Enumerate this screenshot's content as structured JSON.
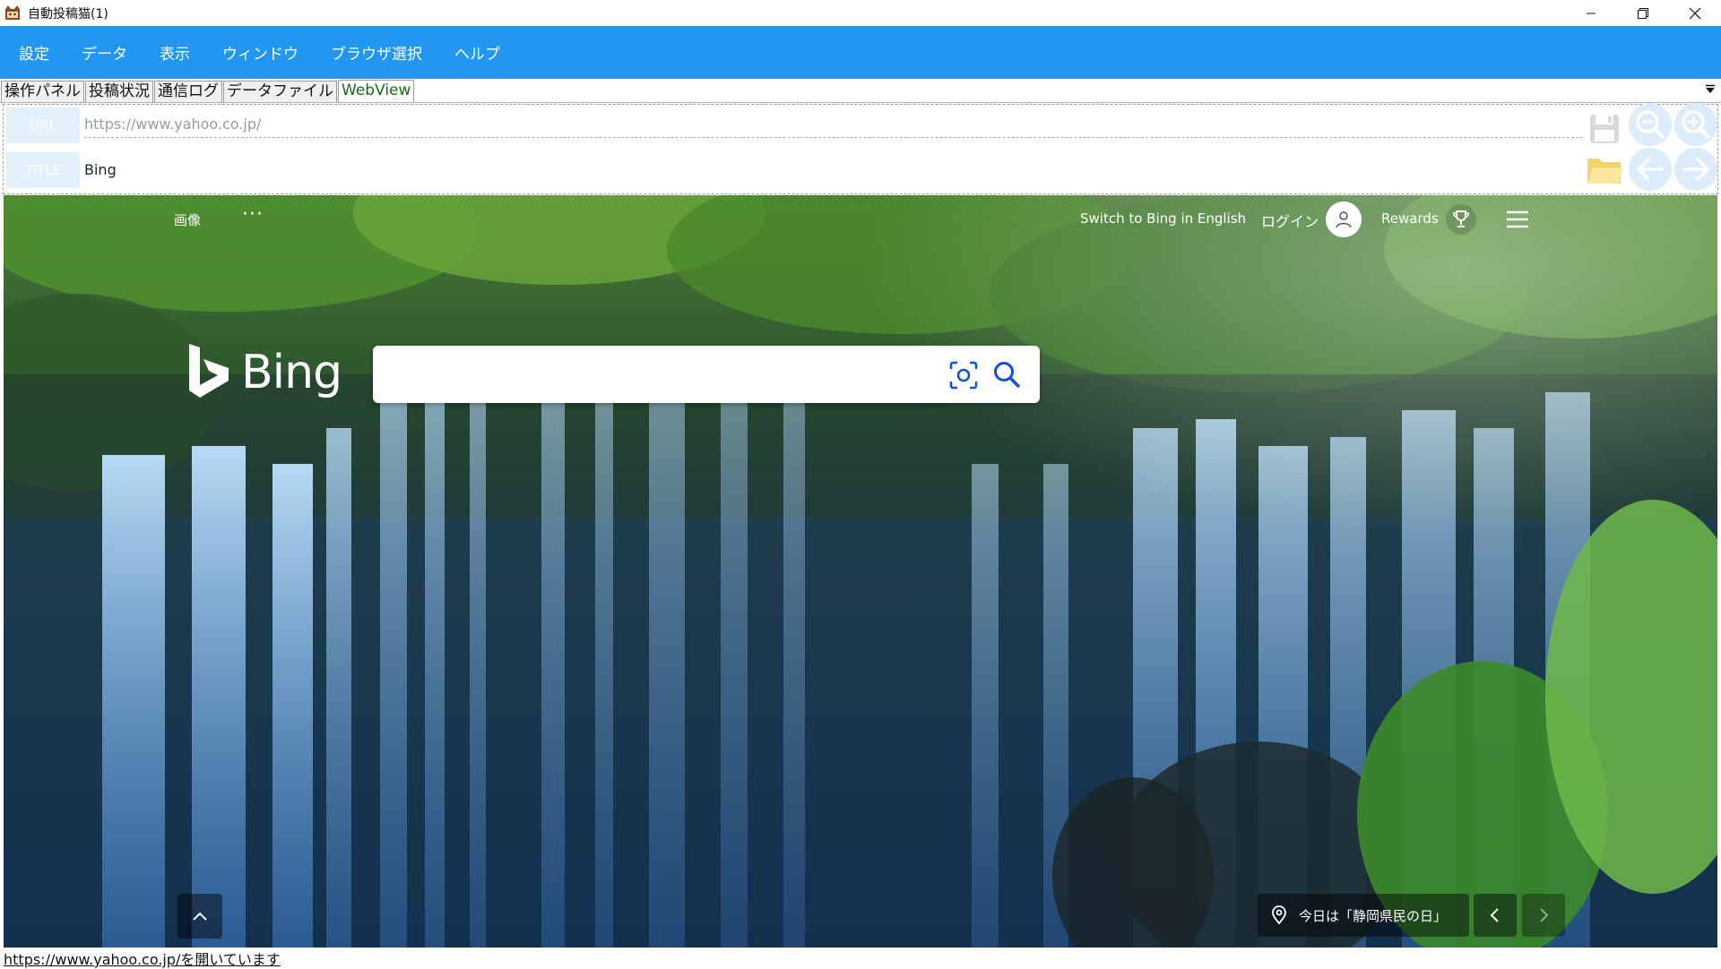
{
  "window": {
    "title": "自動投稿猫(1)",
    "app_icon": "cat-app-icon",
    "controls": [
      "minimize-icon",
      "restore-icon",
      "close-icon"
    ]
  },
  "menu": {
    "items": [
      {
        "label": "設定"
      },
      {
        "label": "データ"
      },
      {
        "label": "表示"
      },
      {
        "label": "ウィンドウ"
      },
      {
        "label": "ブラウザ選択"
      },
      {
        "label": "ヘルプ"
      }
    ],
    "color": "#2196f3"
  },
  "tabs": {
    "items": [
      {
        "label": "操作パネル"
      },
      {
        "label": "投稿状況"
      },
      {
        "label": "通信ログ"
      },
      {
        "label": "データファイル"
      },
      {
        "label": "WebView"
      }
    ],
    "active_index": 4
  },
  "address": {
    "url_label": "URL",
    "url_value": "https://www.yahoo.co.jp/",
    "title_label": "TITLE",
    "title_value": "Bing",
    "tools": [
      "save-icon",
      "zoom-out-icon",
      "zoom-in-icon",
      "open-folder-icon",
      "back-arrow-icon",
      "forward-arrow-icon"
    ]
  },
  "bing": {
    "nav_images": "画像",
    "nav_more": "···",
    "switch_lang": "Switch to Bing in English",
    "login": "ログイン",
    "rewards": "Rewards",
    "logo_text": "Bing",
    "search_value": "",
    "info_text": "今日は「静岡県民の日」"
  },
  "status": {
    "text": "https://www.yahoo.co.jp/を開いています"
  }
}
